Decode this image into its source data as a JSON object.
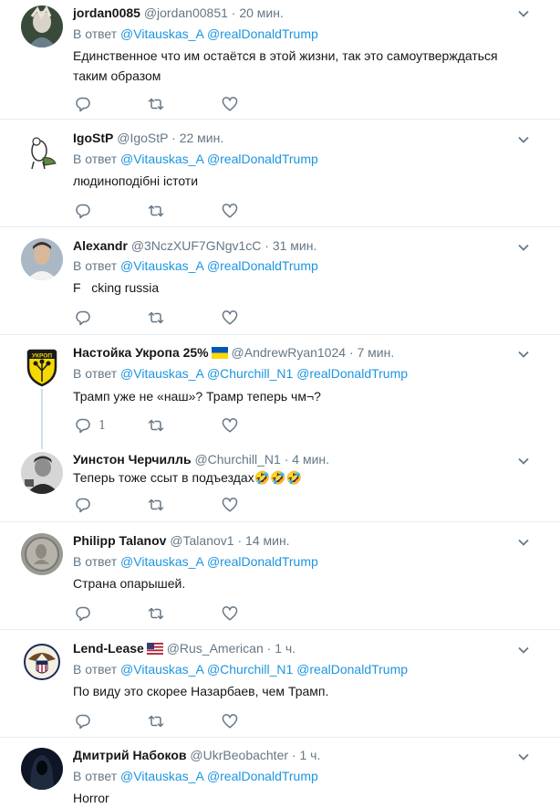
{
  "reply_prefix": "В ответ",
  "tweets": [
    {
      "name": "jordan0085",
      "handle": "@jordan00851",
      "time": "20 мин.",
      "mentions": [
        "@Vitauskas_A",
        "@realDonaldTrump"
      ],
      "text": "Единственное что им остаётся в этой жизни, так это самоутверждаться таким образом",
      "reply_count": ""
    },
    {
      "name": "IgoStP",
      "handle": "@IgoStP",
      "time": "22 мин.",
      "mentions": [
        "@Vitauskas_A",
        "@realDonaldTrump"
      ],
      "text": "людиноподібні істоти",
      "reply_count": ""
    },
    {
      "name": "Alexandr",
      "handle": "@3NczXUF7GNgv1cC",
      "time": "31 мин.",
      "mentions": [
        "@Vitauskas_A",
        "@realDonaldTrump"
      ],
      "text": "F   cking russia",
      "reply_count": ""
    },
    {
      "name": "Настойка Укропа 25%",
      "flag": "ua",
      "handle": "@AndrewRyan1024",
      "time": "7 мин.",
      "mentions": [
        "@Vitauskas_A",
        "@Churchill_N1",
        "@realDonaldTrump"
      ],
      "text": "Трамп уже не «наш»? Трамр теперь чм¬?",
      "reply_count": "1"
    },
    {
      "name": "Уинстон Черчилль",
      "handle": "@Churchill_N1",
      "time": "4 мин.",
      "mentions": [],
      "text": "Теперь тоже ссыт в подъездах🤣🤣🤣",
      "reply_count": ""
    },
    {
      "name": "Philipp Talanov",
      "handle": "@Talanov1",
      "time": "14 мин.",
      "mentions": [
        "@Vitauskas_A",
        "@realDonaldTrump"
      ],
      "text": "Страна опарышей.",
      "reply_count": ""
    },
    {
      "name": "Lend-Lease",
      "flag": "us",
      "handle": "@Rus_American",
      "time": "1 ч.",
      "mentions": [
        "@Vitauskas_A",
        "@Churchill_N1",
        "@realDonaldTrump"
      ],
      "text": "По виду это скорее Назарбаев, чем Трамп.",
      "reply_count": ""
    },
    {
      "name": "Дмитрий Набоков",
      "handle": "@UkrBeobachter",
      "time": "1 ч.",
      "mentions": [
        "@Vitauskas_A",
        "@realDonaldTrump"
      ],
      "text": "Horror",
      "reply_count": ""
    }
  ],
  "colors": {
    "link": "#1b95e0",
    "muted": "#657786",
    "text": "#14171a",
    "separator": "#e6ecf0",
    "thread_line": "#cce1f0"
  },
  "icons": {
    "reply": "reply-icon",
    "retweet": "retweet-icon",
    "like": "like-icon",
    "more": "chevron-down-icon"
  }
}
